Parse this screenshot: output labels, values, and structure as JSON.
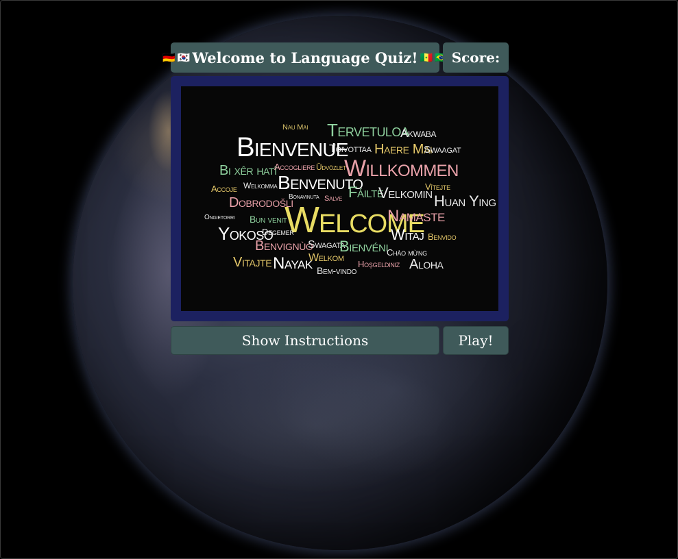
{
  "header": {
    "title": "Welcome to Language Quiz!",
    "flags_left": [
      "🇩🇪",
      "🇰🇷"
    ],
    "flags_right": [
      "🇸🇳",
      "🇧🇷"
    ],
    "score_label": "Score:"
  },
  "word_cloud": {
    "words": [
      {
        "text": "Nau Mai",
        "color": "#d9c26a"
      },
      {
        "text": "Tervetuloa",
        "color": "#8fd19e"
      },
      {
        "text": "Akwaba",
        "color": "#e8e8e8"
      },
      {
        "text": "Bienvenue",
        "color": "#ffffff"
      },
      {
        "text": "Toivottaa",
        "color": "#e8e8e8"
      },
      {
        "text": "Haere Mai",
        "color": "#e6c96a"
      },
      {
        "text": "Swaagat",
        "color": "#e8e8e8"
      },
      {
        "text": "Bi xêr hatî",
        "color": "#8fd19e"
      },
      {
        "text": "Accogliere",
        "color": "#e9a1a9"
      },
      {
        "text": "Üdvözlet",
        "color": "#e6c96a"
      },
      {
        "text": "Willkommen",
        "color": "#e9a1a9"
      },
      {
        "text": "Accoje",
        "color": "#e6c96a"
      },
      {
        "text": "Welkomma",
        "color": "#e8e8e8"
      },
      {
        "text": "Benvenuto",
        "color": "#ffffff"
      },
      {
        "text": "Fáilte",
        "color": "#8fd19e"
      },
      {
        "text": "Velkomin",
        "color": "#e8e8e8"
      },
      {
        "text": "Vítejte",
        "color": "#e6c96a"
      },
      {
        "text": "Dobrodošli",
        "color": "#e9a1a9"
      },
      {
        "text": "Bonavinuta",
        "color": "#e8e8e8"
      },
      {
        "text": "Salve",
        "color": "#e9a1a9"
      },
      {
        "text": "Huan Ying",
        "color": "#e8e8e8"
      },
      {
        "text": "Ongietorri",
        "color": "#e8e8e8"
      },
      {
        "text": "Bun venit",
        "color": "#8fd19e"
      },
      {
        "text": "Welcome",
        "color": "#e8dc63"
      },
      {
        "text": "Namaste",
        "color": "#e9a1a9"
      },
      {
        "text": "Yokoso",
        "color": "#ffffff"
      },
      {
        "text": "Degemer",
        "color": "#e8e8e8"
      },
      {
        "text": "Witaj",
        "color": "#ffffff"
      },
      {
        "text": "Benvido",
        "color": "#e6c96a"
      },
      {
        "text": "Benvignùo",
        "color": "#e9a1a9"
      },
      {
        "text": "Swagata",
        "color": "#e8e8e8"
      },
      {
        "text": "Bienvéni",
        "color": "#8fd19e"
      },
      {
        "text": "Chào mừng",
        "color": "#e8e8e8"
      },
      {
        "text": "Vitajte",
        "color": "#e6c96a"
      },
      {
        "text": "Nayak",
        "color": "#ffffff"
      },
      {
        "text": "Welkom",
        "color": "#e6c96a"
      },
      {
        "text": "Hoşgeldiniz",
        "color": "#e9a1a9"
      },
      {
        "text": "Aloha",
        "color": "#e8e8e8"
      },
      {
        "text": "Bem-vindo",
        "color": "#e8e8e8"
      }
    ]
  },
  "buttons": {
    "instructions_label": "Show Instructions",
    "play_label": "Play!"
  }
}
